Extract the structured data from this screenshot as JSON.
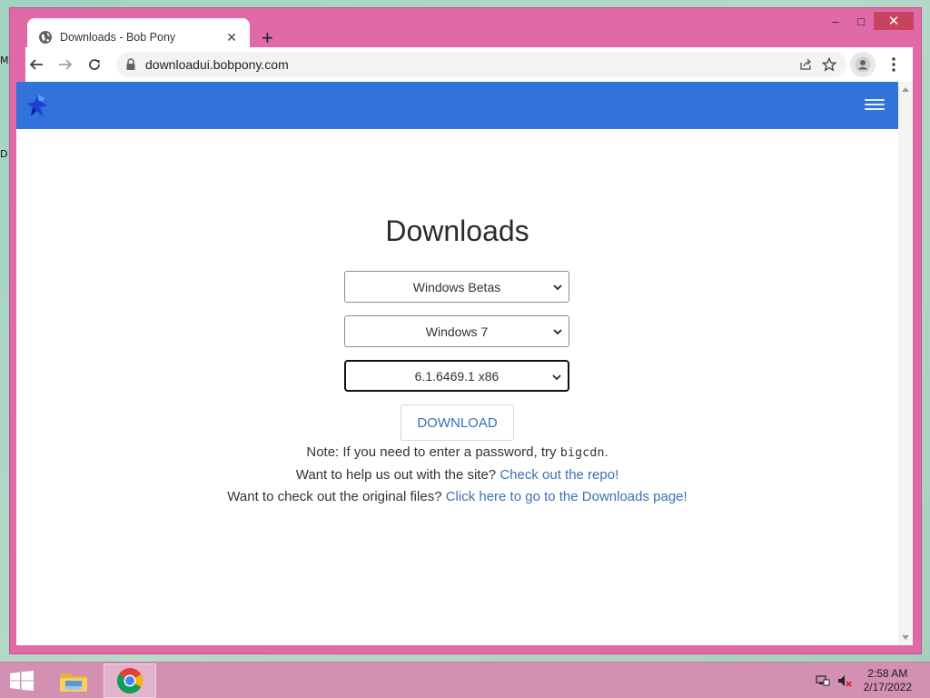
{
  "desktop": {
    "fragments": [
      "M",
      "D"
    ]
  },
  "window": {
    "caption": {
      "minimize": "–",
      "maximize": "□",
      "close": "✕"
    }
  },
  "tab": {
    "title": "Downloads - Bob Pony",
    "icon": "globe-icon",
    "close_glyph": "✕"
  },
  "new_tab_glyph": "+",
  "toolbar": {
    "url": "downloadui.bobpony.com",
    "icons": [
      "back-arrow-icon",
      "forward-arrow-icon",
      "reload-icon",
      "lock-icon",
      "share-icon",
      "star-icon",
      "profile-icon",
      "kebab-menu-icon"
    ]
  },
  "site": {
    "navbar_color": "#3272db",
    "brand_icon": "bob-pony-logo",
    "menu_icon": "hamburger-icon",
    "heading": "Downloads",
    "selects": [
      {
        "value": "Windows Betas"
      },
      {
        "value": "Windows 7"
      },
      {
        "value": "6.1.6469.1 x86"
      }
    ],
    "download_button": "DOWNLOAD",
    "note": {
      "prefix": "Note: If you need to enter a password, try ",
      "code": "bigcdn",
      "suffix": "."
    },
    "help": {
      "text": "Want to help us out with the site? ",
      "link": "Check out the repo!"
    },
    "original": {
      "text": "Want to check out the original files? ",
      "link": "Click here to go to the Downloads page!"
    },
    "link_color": "#3d6fb6"
  },
  "taskbar": {
    "items": [
      "start-button",
      "file-explorer",
      "chrome"
    ],
    "clock": {
      "time": "2:58 AM",
      "date": "2/17/2022"
    }
  }
}
